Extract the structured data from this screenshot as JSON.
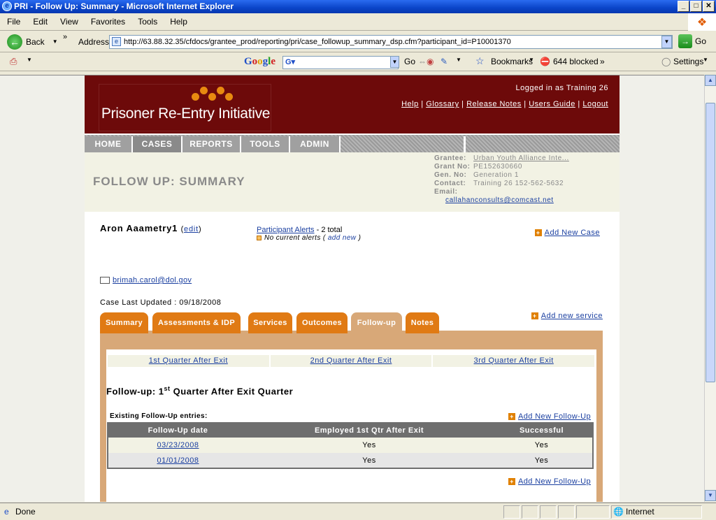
{
  "window": {
    "title": "PRI - Follow Up: Summary - Microsoft Internet Explorer"
  },
  "menu": [
    "File",
    "Edit",
    "View",
    "Favorites",
    "Tools",
    "Help"
  ],
  "toolbar": {
    "back_label": "Back",
    "address_label": "Address",
    "url": "http://63.88.32.35/cfdocs/grantee_prod/reporting/pri/case_followup_summary_dsp.cfm?participant_id=P10001370",
    "go_label": "Go"
  },
  "googlebar": {
    "logo": "Google",
    "search_value": "",
    "go_label": "Go",
    "bookmarks_label": "Bookmarks",
    "blocked_label": "644 blocked",
    "settings_label": "Settings"
  },
  "status": {
    "text": "Done",
    "zone": "Internet"
  },
  "site": {
    "logo_text": "Prisoner Re-Entry Initiative",
    "logged_in": "Logged in as Training 26",
    "links": [
      "Help",
      "Glossary",
      "Release Notes",
      "Users Guide",
      "Logout"
    ],
    "nav": [
      "HOME",
      "CASES",
      "REPORTS",
      "TOOLS",
      "ADMIN"
    ],
    "active_nav": "CASES"
  },
  "page": {
    "title": "FOLLOW UP: SUMMARY",
    "grantee_label": "Grantee:",
    "grantee_value": "Urban Youth Alliance Inte...",
    "grant_no_label": "Grant No:",
    "grant_no_value": "PE152630660",
    "gen_no_label": "Gen. No:",
    "gen_no_value": "Generation 1",
    "contact_label": "Contact:",
    "contact_value": "Training 26  152-562-5632",
    "email_label": "Email:",
    "email_value": "callahanconsults@comcast.net"
  },
  "participant": {
    "name": "Aron Aaametry1",
    "edit_label": "edit",
    "alerts_link": "Participant Alerts",
    "alerts_total": "- 2 total",
    "no_alerts": "No current alerts (",
    "add_new": "add new",
    "add_new_case": "Add New Case",
    "email": "brimah.carol@dol.gov",
    "last_updated": "Case Last Updated : 09/18/2008",
    "add_new_service": "Add new service"
  },
  "tabs": [
    "Summary",
    "Assessments & IDP",
    "Services",
    "Outcomes",
    "Follow-up",
    "Notes"
  ],
  "active_tab": "Follow-up",
  "quarters": [
    "1st Quarter After Exit",
    "2nd Quarter After Exit",
    "3rd Quarter After Exit"
  ],
  "followup": {
    "title_prefix": "Follow-up: 1",
    "title_sup": "st",
    "title_suffix": " Quarter After Exit Quarter",
    "existing_label": "Existing Follow-Up entries:",
    "add_label": "Add New Follow-Up",
    "columns": [
      "Follow-Up date",
      "Employed 1st Qtr After Exit",
      "Successful"
    ],
    "rows": [
      {
        "date": "03/23/2008",
        "employed": "Yes",
        "successful": "Yes"
      },
      {
        "date": "01/01/2008",
        "employed": "Yes",
        "successful": "Yes"
      }
    ]
  }
}
